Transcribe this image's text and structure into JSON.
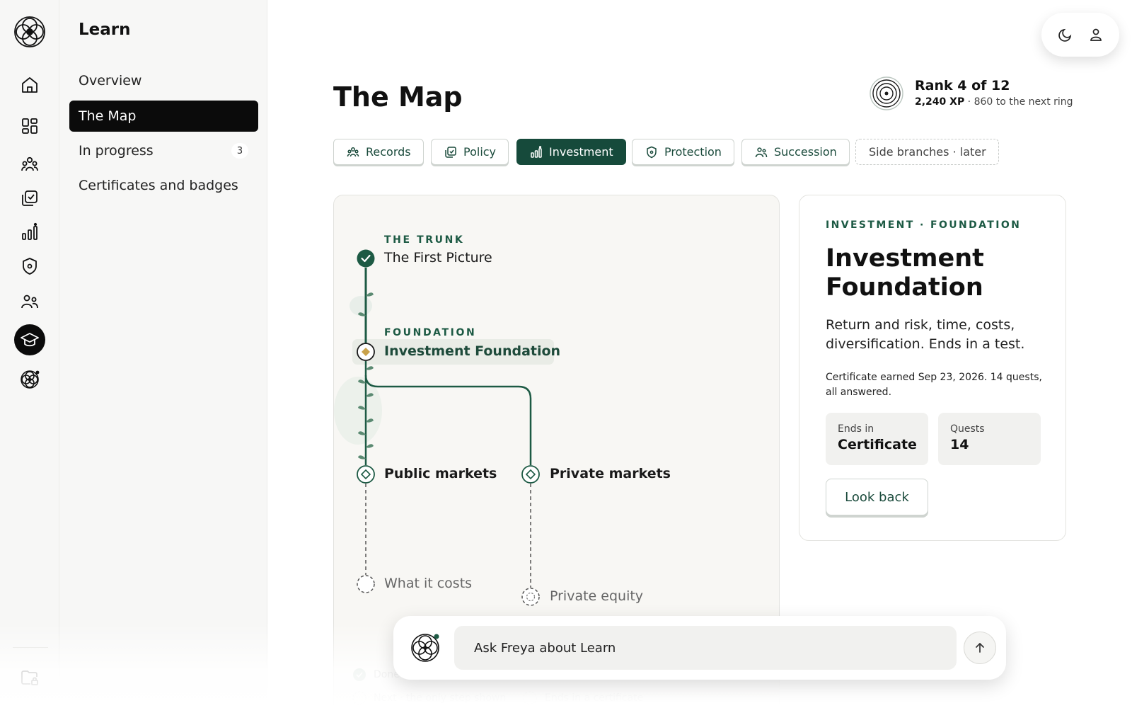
{
  "rail": {
    "items": [
      {
        "icon": "home-icon"
      },
      {
        "icon": "dashboard-icon"
      },
      {
        "icon": "people-icon"
      },
      {
        "icon": "policy-icon"
      },
      {
        "icon": "chart-icon"
      },
      {
        "icon": "shield-icon"
      },
      {
        "icon": "family-icon"
      },
      {
        "icon": "graduation-cap-icon",
        "active": true
      },
      {
        "icon": "freya-icon"
      }
    ],
    "bottom_icon": "locked-folder-icon"
  },
  "nav": {
    "title": "Learn",
    "items": [
      {
        "label": "Overview"
      },
      {
        "label": "The Map",
        "active": true
      },
      {
        "label": "In progress",
        "count": "3"
      },
      {
        "label": "Certificates and badges"
      }
    ]
  },
  "header": {
    "title": "The Map",
    "rank": {
      "title": "Rank 4 of 12",
      "xp": "2,240 XP",
      "next": " · 860 to the next ring"
    }
  },
  "tabs": [
    {
      "label": "Records",
      "icon": "people-icon"
    },
    {
      "label": "Policy",
      "icon": "policy-icon"
    },
    {
      "label": "Investment",
      "icon": "chart-icon",
      "active": true
    },
    {
      "label": "Protection",
      "icon": "shield-icon"
    },
    {
      "label": "Succession",
      "icon": "family-icon"
    },
    {
      "label": "Side branches · later",
      "dashed": true
    }
  ],
  "map": {
    "trunk": {
      "kicker": "THE TRUNK",
      "label": "The First Picture",
      "state": "done"
    },
    "foundation": {
      "kicker": "FOUNDATION",
      "label": "Investment Foundation",
      "state": "current"
    },
    "branches": [
      {
        "label": "Public markets",
        "next": "What it costs"
      },
      {
        "label": "Private markets",
        "next": "Private equity"
      }
    ],
    "legend": [
      "Done",
      "Next · the only step shown",
      "Ends in a certificate"
    ]
  },
  "detail": {
    "kicker": "INVESTMENT · FOUNDATION",
    "title": "Investment Foundation",
    "description": "Return and risk, time, costs, diversification. Ends in a test.",
    "certificate": "Certificate earned Sep 23, 2026. 14 quests, all answered.",
    "stats": [
      {
        "key": "Ends in",
        "value": "Certificate"
      },
      {
        "key": "Quests",
        "value": "14"
      }
    ],
    "action": "Look back"
  },
  "ask": {
    "placeholder": "Ask Freya about Learn"
  },
  "colors": {
    "accent": "#164a3b",
    "leaf": "#5b8a72",
    "gold": "#c9a24a",
    "nav_active": "#0b0b0b"
  }
}
